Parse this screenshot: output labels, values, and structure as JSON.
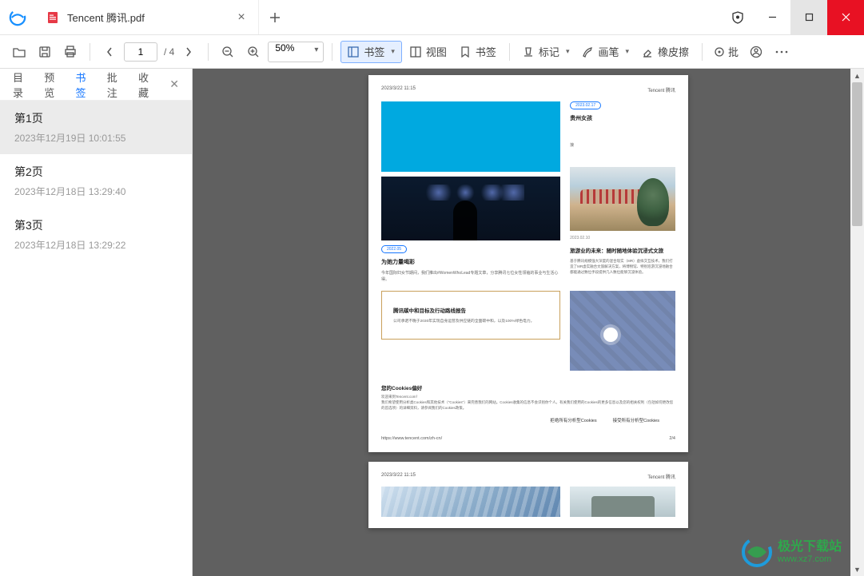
{
  "titlebar": {
    "tab_title": "Tencent 腾讯.pdf"
  },
  "toolbar": {
    "page_current": "1",
    "page_total": "/ 4",
    "zoom": "50%",
    "bookmark_label": "书签",
    "view_label": "视图",
    "bookmark2_label": "书签",
    "mark_label": "标记",
    "brush_label": "画笔",
    "eraser_label": "橡皮擦",
    "approve_label": "批"
  },
  "sidetabs": {
    "catalog": "目录",
    "preview": "预览",
    "bookmark": "书签",
    "annotation": "批注",
    "favorite": "收藏"
  },
  "bookmarks": [
    {
      "title": "第1页",
      "date": "2023年12月19日 10:01:55"
    },
    {
      "title": "第2页",
      "date": "2023年12月18日 13:29:40"
    },
    {
      "title": "第3页",
      "date": "2023年12月18日 13:29:22"
    }
  ],
  "doc": {
    "page_ts": "2023/3/22 11:15",
    "brand": "Tencent 腾讯",
    "side_date1": "2023.02.17",
    "side_title1": "贵州女孩",
    "side_frag": "接",
    "main_date": "2022.05",
    "main_title": "为她力量喝彩",
    "main_body": "今年国际妇女节期间，我们推出#WomenWhoLead专题文章，分享腾讯七位女性领袖的事业与生活心得。",
    "side_date2": "2023.02.10",
    "side_title2": "旅游业的未来：随时随地体验沉浸式文旅",
    "side_body2": "基于腾讯规模强大深度的混合现实（MR）虚拟交互技术，我们打造了MR虚实融合文旅解决方案，将博物馆、特别巡游沉浸地融合都能通过数位手段提供几人数位能够沉浸体验。",
    "report_title": "腾讯碳中和目标及行动路线报告",
    "report_body": "公司承诺不晚于2030年实现自身运营及供应链的全面碳中和，以及100%绿色电力。",
    "cookie_title": "您的Cookies偏好",
    "cookie_sub": "欢迎来到Tencent.com！",
    "cookie_body": "我们希望使用分析类Cookies和其他技术（\"Cookies\"）来完善我们的网站。Cookies收集的信息不会识别你个人。有关我们使用的Cookies的更多信息以及您的相关权利（包括如何更改您的首选项）的详细资料，请参阅我们的Cookies政策。",
    "cookie_reject": "拒绝所有分析型Cookies",
    "cookie_accept": "接受所有分析型Cookies",
    "footer_url": "https://www.tencent.com/zh-cn/",
    "footer_page": "2/4"
  },
  "watermark": {
    "line1": "极光下载站",
    "line2": "www.xz7.com"
  }
}
